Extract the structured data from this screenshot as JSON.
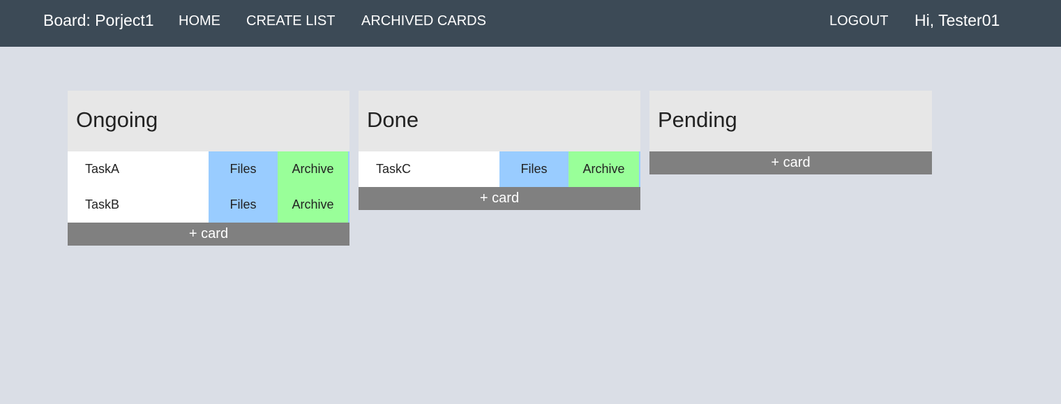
{
  "navbar": {
    "brand": "Board: Porject1",
    "home": "HOME",
    "create_list": "CREATE LIST",
    "archived_cards": "ARCHIVED CARDS",
    "logout": "LOGOUT",
    "greeting": "Hi, Tester01"
  },
  "colors": {
    "navbar_bg": "#3c4a56",
    "page_bg": "#dadee6",
    "files_button": "#99ccff",
    "archive_button": "#99ff99",
    "add_card_bg": "#808080"
  },
  "lists": [
    {
      "title": "Ongoing",
      "cards": [
        {
          "name": "TaskA",
          "files_label": "Files",
          "archive_label": "Archive"
        },
        {
          "name": "TaskB",
          "files_label": "Files",
          "archive_label": "Archive"
        }
      ],
      "add_card_label": "+ card"
    },
    {
      "title": "Done",
      "cards": [
        {
          "name": "TaskC",
          "files_label": "Files",
          "archive_label": "Archive"
        }
      ],
      "add_card_label": "+ card"
    },
    {
      "title": "Pending",
      "cards": [],
      "add_card_label": "+ card"
    }
  ]
}
